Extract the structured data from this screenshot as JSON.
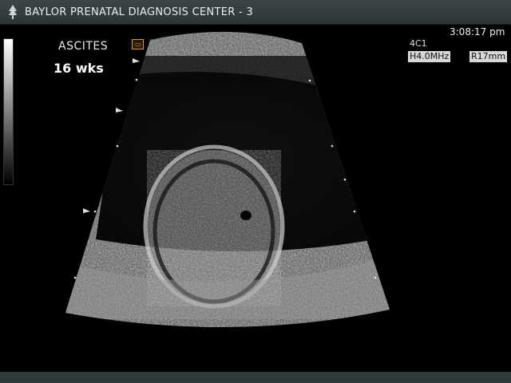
{
  "header": {
    "title": "BAYLOR PRENATAL DIAGNOSIS CENTER - 3",
    "logo_icon": "tree-logo-icon"
  },
  "annotation": {
    "label": "ASCITES",
    "gestational_age": "16 wks"
  },
  "status": {
    "time": "3:08:17 pm",
    "probe": "4C1",
    "frequency": "H4.0MHz",
    "range": "R17mm"
  },
  "icons": {
    "badge": "cine-badge-icon",
    "depth_marker": "arrowhead-marker-icon"
  },
  "colors": {
    "header_bg": "#3c4647",
    "badge": "#d89a1a",
    "background": "#000000"
  }
}
